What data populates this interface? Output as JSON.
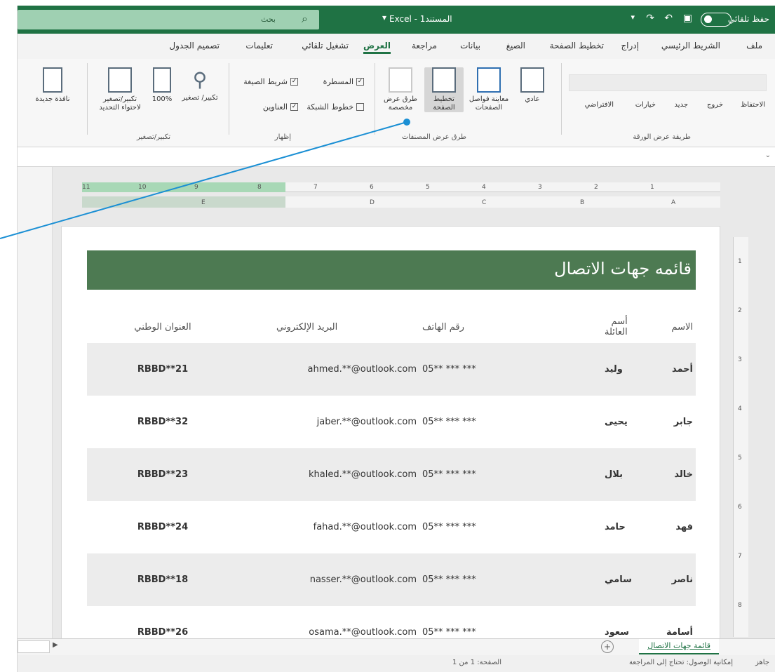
{
  "titlebar": {
    "autosave_label": "حفظ تلقائي",
    "doc_title": "Excel - المستند1",
    "search_placeholder": "بحث"
  },
  "ribbon_tabs": [
    "ملف",
    "الشريط الرئيسي",
    "إدراج",
    "تخطيط الصفحة",
    "الصيغ",
    "بيانات",
    "مراجعة",
    "العرض",
    "تشغيل تلقائي",
    "تعليمات",
    "تصميم الجدول"
  ],
  "active_tab": "العرض",
  "ribbon": {
    "workbook_views_label": "طرق عرض المصنفات",
    "view_normal": "عادي",
    "view_page_break": "معاينة فواصل الصفحات",
    "view_page_layout": "تخطيط الصفحة",
    "view_custom": "طرق عرض مخصصة",
    "show_label": "إظهار",
    "chk_ruler": "المسطرة",
    "chk_formula_bar": "شريط الصيغة",
    "chk_gridlines": "خطوط الشبكة",
    "chk_headings": "العناوين",
    "zoom_label": "تكبير/تصغير",
    "zoom_btn": "تكبير/ تصغير",
    "zoom_100": "100%",
    "zoom_selection": "تكبير/تصغير لاحتواء التحديد",
    "new_window": "نافذة جديدة",
    "sheet_view_label": "طريقة عرض الورقة",
    "sheet_view_keep": "الاحتفاظ",
    "sheet_view_exit": "خروج",
    "sheet_view_new": "جديد",
    "sheet_view_options": "خيارات",
    "sheet_view_default": "الافتراضي"
  },
  "ruler": {
    "top_nums": [
      "11",
      "10",
      "9",
      "8",
      "7",
      "6",
      "5",
      "4",
      "3",
      "2",
      "1"
    ],
    "col_letters": [
      "E",
      "D",
      "C",
      "B",
      "A"
    ],
    "side_nums": [
      "1",
      "2",
      "3",
      "4",
      "5",
      "6",
      "7",
      "8"
    ]
  },
  "contacts": {
    "title": "قائمه جهات الاتصال",
    "headers": {
      "name": "الاسم",
      "family": "أسم العائلة",
      "phone": "رقم الهاتف",
      "email": "البريد الإلكتروني",
      "address": "العنوان الوطني"
    },
    "rows": [
      {
        "name": "أحمد",
        "family": "وليد",
        "phone": "05** *** ***",
        "email": "ahmed.**@outlook.com",
        "address": "RBBD**21"
      },
      {
        "name": "جابر",
        "family": "يحيى",
        "phone": "05** *** ***",
        "email": "jaber.**@outlook.com",
        "address": "RBBD**32"
      },
      {
        "name": "خالد",
        "family": "بلال",
        "phone": "05** *** ***",
        "email": "khaled.**@outlook.com",
        "address": "RBBD**23"
      },
      {
        "name": "فهد",
        "family": "حامد",
        "phone": "05** *** ***",
        "email": "fahad.**@outlook.com",
        "address": "RBBD**24"
      },
      {
        "name": "ناصر",
        "family": "سامي",
        "phone": "05** *** ***",
        "email": "nasser.**@outlook.com",
        "address": "RBBD**18"
      },
      {
        "name": "أسامة",
        "family": "سعود",
        "phone": "05** *** ***",
        "email": "osama.**@outlook.com",
        "address": "RBBD**26"
      }
    ]
  },
  "sheetbar": {
    "sheet_tab": "قائمة جهات الاتصال",
    "add_sheet": "+"
  },
  "statusbar": {
    "ready": "جاهز",
    "accessibility": "إمكانية الوصول: تحتاج إلى المراجعة",
    "page": "الصفحة: 1 من 1"
  },
  "colors": {
    "excel_green": "#1f7244",
    "banner_green": "#4d7a52",
    "callout_blue": "#1a8fd4"
  }
}
